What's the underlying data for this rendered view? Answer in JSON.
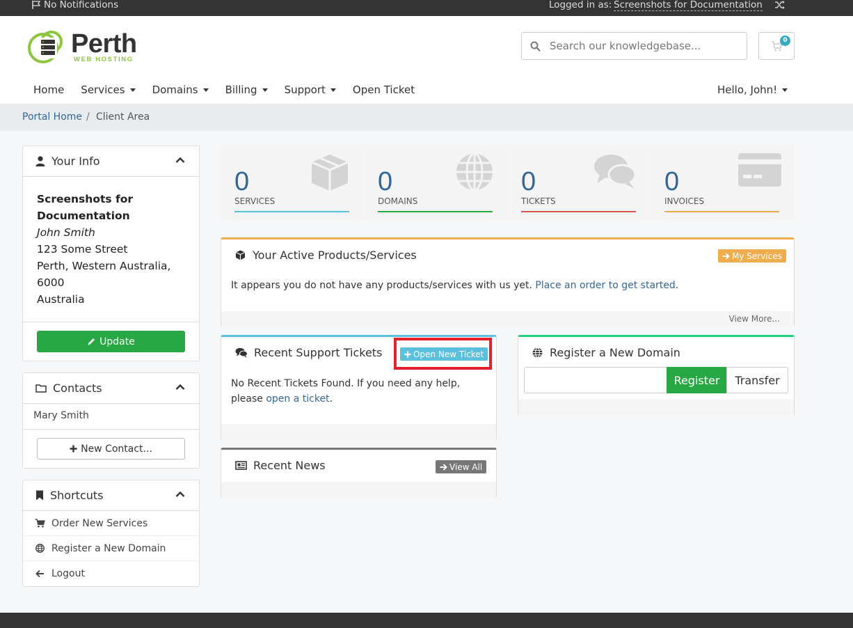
{
  "topbar": {
    "notifications": "No Notifications",
    "logged_in_label": "Logged in as:",
    "logged_in_user": "Screenshots for Documentation"
  },
  "brand": {
    "name": "Perth",
    "tagline": "WEB HOSTING",
    "accent": "#8cc63f"
  },
  "search": {
    "placeholder": "Search our knowledgebase..."
  },
  "cart": {
    "count": "0"
  },
  "nav": {
    "home": "Home",
    "services": "Services",
    "domains": "Domains",
    "billing": "Billing",
    "support": "Support",
    "open_ticket": "Open Ticket",
    "hello": "Hello, John!"
  },
  "breadcrumb": {
    "home": "Portal Home",
    "sep": "/",
    "current": "Client Area"
  },
  "your_info": {
    "title": "Your Info",
    "company_line1": "Screenshots for",
    "company_line2": "Documentation",
    "person": "John Smith",
    "street": "123 Some Street",
    "city": "Perth, Western Australia,",
    "postcode": "6000",
    "country": "Australia",
    "update_label": "Update"
  },
  "contacts": {
    "title": "Contacts",
    "items": [
      "Mary Smith"
    ],
    "new_label": "New Contact..."
  },
  "shortcuts": {
    "title": "Shortcuts",
    "items": [
      "Order New Services",
      "Register a New Domain",
      "Logout"
    ]
  },
  "stats": [
    {
      "num": "0",
      "label": "SERVICES",
      "color": "#5bc0de"
    },
    {
      "num": "0",
      "label": "DOMAINS",
      "color": "#28a745"
    },
    {
      "num": "0",
      "label": "TICKETS",
      "color": "#d9534f"
    },
    {
      "num": "0",
      "label": "INVOICES",
      "color": "#f0ad4e"
    }
  ],
  "products": {
    "title": "Your Active Products/Services",
    "button": "My Services",
    "text": "It appears you do not have any products/services with us yet.",
    "link": "Place an order to get started",
    "period": ".",
    "view_more": "View More..."
  },
  "tickets": {
    "title": "Recent Support Tickets",
    "button": "Open New Ticket",
    "text": "No Recent Tickets Found. If you need any help, please",
    "link": "open a ticket",
    "period": "."
  },
  "domain": {
    "title": "Register a New Domain",
    "register": "Register",
    "transfer": "Transfer"
  },
  "news": {
    "title": "Recent News",
    "button": "View All"
  }
}
